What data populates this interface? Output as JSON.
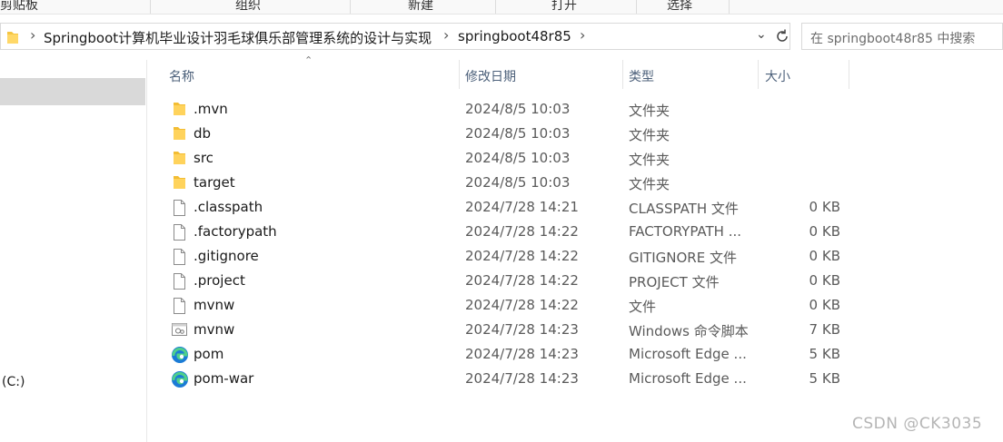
{
  "ribbon": {
    "groups": [
      "剪贴板",
      "组织",
      "新建",
      "打开",
      "选择"
    ]
  },
  "address": {
    "crumbs": [
      "Springboot计算机毕业设计羽毛球俱乐部管理系统的设计与实现",
      "springboot48r85"
    ],
    "search_placeholder": "在 springboot48r85 中搜索"
  },
  "nav": {
    "drive_label": "(C:)"
  },
  "columns": {
    "name": "名称",
    "date": "修改日期",
    "type": "类型",
    "size": "大小"
  },
  "files": [
    {
      "name": ".mvn",
      "date": "2024/8/5 10:03",
      "type": "文件夹",
      "size": "",
      "icon": "folder-icon"
    },
    {
      "name": "db",
      "date": "2024/8/5 10:03",
      "type": "文件夹",
      "size": "",
      "icon": "folder-icon"
    },
    {
      "name": "src",
      "date": "2024/8/5 10:03",
      "type": "文件夹",
      "size": "",
      "icon": "folder-icon"
    },
    {
      "name": "target",
      "date": "2024/8/5 10:03",
      "type": "文件夹",
      "size": "",
      "icon": "folder-icon"
    },
    {
      "name": ".classpath",
      "date": "2024/7/28 14:21",
      "type": "CLASSPATH 文件",
      "size": "0 KB",
      "icon": "file-icon"
    },
    {
      "name": ".factorypath",
      "date": "2024/7/28 14:22",
      "type": "FACTORYPATH ...",
      "size": "0 KB",
      "icon": "file-icon"
    },
    {
      "name": ".gitignore",
      "date": "2024/7/28 14:22",
      "type": "GITIGNORE 文件",
      "size": "0 KB",
      "icon": "file-icon"
    },
    {
      "name": ".project",
      "date": "2024/7/28 14:22",
      "type": "PROJECT 文件",
      "size": "0 KB",
      "icon": "file-icon"
    },
    {
      "name": "mvnw",
      "date": "2024/7/28 14:22",
      "type": "文件",
      "size": "0 KB",
      "icon": "file-icon"
    },
    {
      "name": "mvnw",
      "date": "2024/7/28 14:23",
      "type": "Windows 命令脚本",
      "size": "7 KB",
      "icon": "script-icon"
    },
    {
      "name": "pom",
      "date": "2024/7/28 14:23",
      "type": "Microsoft Edge ...",
      "size": "5 KB",
      "icon": "edge-icon"
    },
    {
      "name": "pom-war",
      "date": "2024/7/28 14:23",
      "type": "Microsoft Edge ...",
      "size": "5 KB",
      "icon": "edge-icon"
    }
  ],
  "watermark": "CSDN @CK3035"
}
